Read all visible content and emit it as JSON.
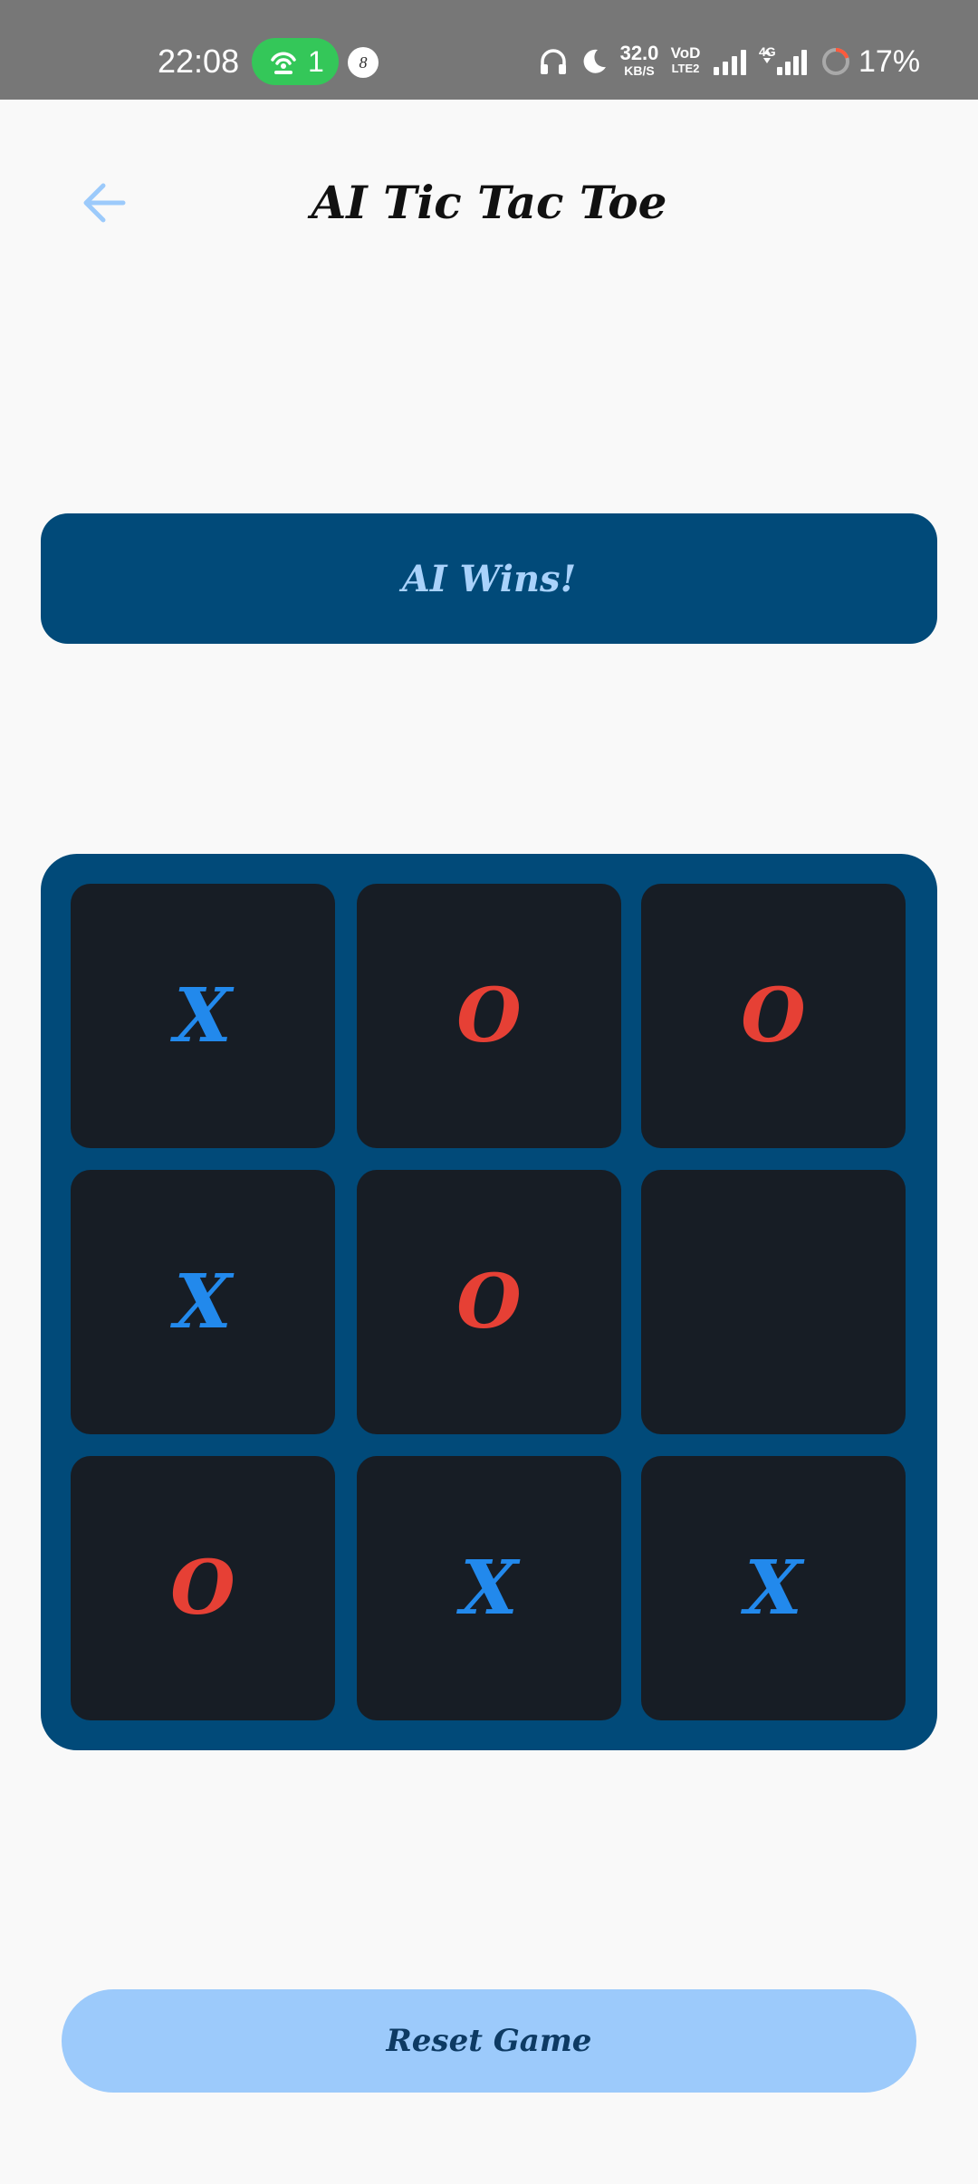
{
  "status_bar": {
    "time": "22:08",
    "hotspot_count": "1",
    "notification_count": "8",
    "network_speed_value": "32.0",
    "network_speed_unit": "KB/S",
    "volte_line1": "VoD",
    "volte_line2": "LTE2",
    "network_type": "4G",
    "battery_percent": "17%",
    "icons": [
      "hotspot-icon",
      "headphones-icon",
      "moon-icon",
      "signal-icon",
      "signal-icon",
      "battery-ring-icon"
    ]
  },
  "app_bar": {
    "back_icon": "arrow-left-icon",
    "title": "AI Tic Tac Toe"
  },
  "game": {
    "status_message": "AI Wins!",
    "board": [
      [
        "X",
        "O",
        "O"
      ],
      [
        "X",
        "O",
        ""
      ],
      [
        "O",
        "X",
        "X"
      ]
    ]
  },
  "controls": {
    "reset_label": "Reset Game"
  },
  "colors": {
    "background": "#f9f9f9",
    "status_bar": "#777777",
    "panel": "#014a79",
    "cell": "#171d25",
    "x_mark": "#2289ec",
    "o_mark": "#e64035",
    "banner_text": "#a9d2fb",
    "back_arrow": "#9ccafb",
    "reset_bg": "#9ccafb",
    "reset_text": "#0d3a63"
  }
}
